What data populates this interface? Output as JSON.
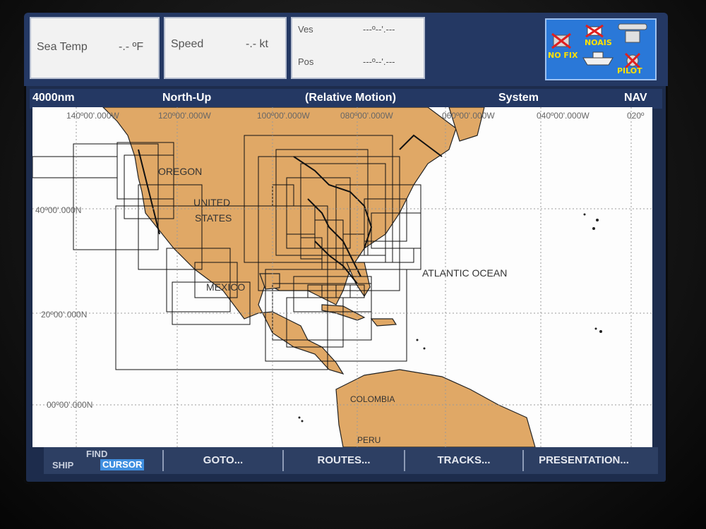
{
  "databoxes": {
    "sea_temp": {
      "label": "Sea Temp",
      "value": "-.- ºF"
    },
    "speed": {
      "label": "Speed",
      "value": "-.- kt"
    },
    "ves_label": "Ves",
    "ves_value": "---º--'.---",
    "pos_label": "Pos",
    "pos_value": "---º--'.---"
  },
  "status": {
    "no_fix": "NO FIX",
    "no_ais": "NOAIS",
    "pilot": "PILOT"
  },
  "header": {
    "range": "4000nm",
    "orientation": "North-Up",
    "motion": "(Relative Motion)",
    "system": "System",
    "mode": "NAV"
  },
  "chart": {
    "lon_labels": [
      "140º00'.000W",
      "120º00'.000W",
      "100º00'.000W",
      "080º00'.000W",
      "060º00'.000W",
      "040º00'.000W",
      "020º"
    ],
    "lat_labels": [
      "40º00'.000N",
      "20º00'.000N",
      "00º00'.000N"
    ],
    "places": [
      "OREGON",
      "UNITED",
      "STATES",
      "MEXICO",
      "ATLANTIC OCEAN",
      "COLOMBIA",
      "PERU"
    ]
  },
  "softkeys": {
    "find": "FIND",
    "ship": "SHIP",
    "cursor": "CURSOR",
    "goto": "GOTO...",
    "routes": "ROUTES...",
    "tracks": "TRACKS...",
    "presentation": "PRESENTATION..."
  },
  "colors": {
    "land": "#e0a866",
    "sea": "#fdfdfd",
    "accent": "#2a78d8",
    "status_text": "#ffe000"
  }
}
